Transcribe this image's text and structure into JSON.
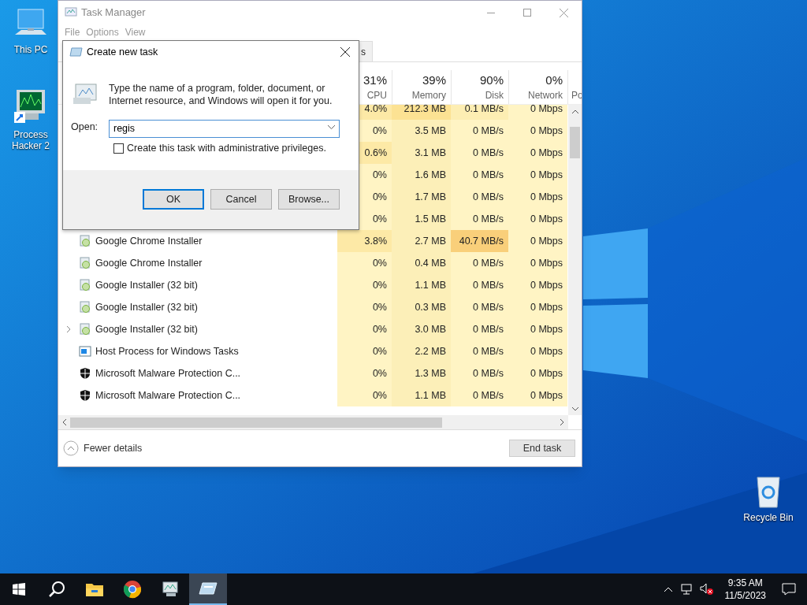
{
  "desktop_icons": [
    {
      "label": "This PC",
      "kind": "pc"
    },
    {
      "label": "Process Hacker 2",
      "kind": "hacker"
    },
    {
      "label": "Recycle Bin",
      "kind": "bin"
    }
  ],
  "task_manager": {
    "title": "Task Manager",
    "active": false,
    "menu": [
      "File",
      "Options",
      "View"
    ],
    "tabs": [
      {
        "label": "s",
        "selected": true
      }
    ],
    "columns": [
      {
        "percent": "31%",
        "label": "CPU"
      },
      {
        "percent": "39%",
        "label": "Memory"
      },
      {
        "percent": "90%",
        "label": "Disk"
      },
      {
        "percent": "0%",
        "label": "Network"
      },
      {
        "label": "Po"
      }
    ],
    "rows": [
      {
        "cells": [
          {
            "text": "4.0%",
            "color": "#fde9a6"
          },
          {
            "text": "212.3 MB",
            "color": "#fce293"
          },
          {
            "text": "0.1 MB/s",
            "color": "#fdeeb3"
          },
          {
            "text": "0 Mbps",
            "color": "#fff4c4"
          }
        ]
      },
      {
        "cells": [
          {
            "text": "0%",
            "color": "#fff4c4"
          },
          {
            "text": "3.5 MB",
            "color": "#fcefb8"
          },
          {
            "text": "0 MB/s",
            "color": "#fff4c4"
          },
          {
            "text": "0 Mbps",
            "color": "#fff4c4"
          }
        ]
      },
      {
        "cells": [
          {
            "text": "0.6%",
            "color": "#fde9a6"
          },
          {
            "text": "3.1 MB",
            "color": "#fcefb8"
          },
          {
            "text": "0 MB/s",
            "color": "#fff4c4"
          },
          {
            "text": "0 Mbps",
            "color": "#fff4c4"
          }
        ]
      },
      {
        "cells": [
          {
            "text": "0%",
            "color": "#fff4c4"
          },
          {
            "text": "1.6 MB",
            "color": "#fcefb8"
          },
          {
            "text": "0 MB/s",
            "color": "#fff4c4"
          },
          {
            "text": "0 Mbps",
            "color": "#fff4c4"
          }
        ]
      },
      {
        "cells": [
          {
            "text": "0%",
            "color": "#fff4c4"
          },
          {
            "text": "1.7 MB",
            "color": "#fcefb8"
          },
          {
            "text": "0 MB/s",
            "color": "#fff4c4"
          },
          {
            "text": "0 Mbps",
            "color": "#fff4c4"
          }
        ]
      },
      {
        "cells": [
          {
            "text": "0%",
            "color": "#fff4c4"
          },
          {
            "text": "1.5 MB",
            "color": "#fcefb8"
          },
          {
            "text": "0 MB/s",
            "color": "#fff4c4"
          },
          {
            "text": "0 Mbps",
            "color": "#fff4c4"
          }
        ]
      },
      {
        "name": "Google Chrome Installer",
        "kind": "installer",
        "expandable": false,
        "cells": [
          {
            "text": "3.8%",
            "color": "#fde9a6"
          },
          {
            "text": "2.7 MB",
            "color": "#fcefb8"
          },
          {
            "text": "40.7 MB/s",
            "color": "#f9cf7a"
          },
          {
            "text": "0 Mbps",
            "color": "#fff4c4"
          }
        ]
      },
      {
        "name": "Google Chrome Installer",
        "kind": "installer",
        "expandable": false,
        "cells": [
          {
            "text": "0%",
            "color": "#fff4c4"
          },
          {
            "text": "0.4 MB",
            "color": "#fcefb8"
          },
          {
            "text": "0 MB/s",
            "color": "#fff4c4"
          },
          {
            "text": "0 Mbps",
            "color": "#fff4c4"
          }
        ]
      },
      {
        "name": "Google Installer (32 bit)",
        "kind": "installer",
        "expandable": false,
        "cells": [
          {
            "text": "0%",
            "color": "#fff4c4"
          },
          {
            "text": "1.1 MB",
            "color": "#fcefb8"
          },
          {
            "text": "0 MB/s",
            "color": "#fff4c4"
          },
          {
            "text": "0 Mbps",
            "color": "#fff4c4"
          }
        ]
      },
      {
        "name": "Google Installer (32 bit)",
        "kind": "installer",
        "expandable": false,
        "cells": [
          {
            "text": "0%",
            "color": "#fff4c4"
          },
          {
            "text": "0.3 MB",
            "color": "#fcefb8"
          },
          {
            "text": "0 MB/s",
            "color": "#fff4c4"
          },
          {
            "text": "0 Mbps",
            "color": "#fff4c4"
          }
        ]
      },
      {
        "name": "Google Installer (32 bit)",
        "kind": "installer",
        "expandable": true,
        "cells": [
          {
            "text": "0%",
            "color": "#fff4c4"
          },
          {
            "text": "3.0 MB",
            "color": "#fcefb8"
          },
          {
            "text": "0 MB/s",
            "color": "#fff4c4"
          },
          {
            "text": "0 Mbps",
            "color": "#fff4c4"
          }
        ]
      },
      {
        "name": "Host Process for Windows Tasks",
        "kind": "window",
        "expandable": false,
        "cells": [
          {
            "text": "0%",
            "color": "#fff4c4"
          },
          {
            "text": "2.2 MB",
            "color": "#fcefb8"
          },
          {
            "text": "0 MB/s",
            "color": "#fff4c4"
          },
          {
            "text": "0 Mbps",
            "color": "#fff4c4"
          }
        ]
      },
      {
        "name": "Microsoft Malware Protection C...",
        "kind": "shield",
        "expandable": false,
        "cells": [
          {
            "text": "0%",
            "color": "#fff4c4"
          },
          {
            "text": "1.3 MB",
            "color": "#fcefb8"
          },
          {
            "text": "0 MB/s",
            "color": "#fff4c4"
          },
          {
            "text": "0 Mbps",
            "color": "#fff4c4"
          }
        ]
      },
      {
        "name": "Microsoft Malware Protection C...",
        "kind": "shield",
        "expandable": false,
        "cells": [
          {
            "text": "0%",
            "color": "#fff4c4"
          },
          {
            "text": "1.1 MB",
            "color": "#fcefb8"
          },
          {
            "text": "0 MB/s",
            "color": "#fff4c4"
          },
          {
            "text": "0 Mbps",
            "color": "#fff4c4"
          }
        ]
      }
    ],
    "fewer_details": "Fewer details",
    "end_task": "End task"
  },
  "dialog": {
    "title": "Create new task",
    "message": "Type the name of a program, folder, document, or Internet resource, and Windows will open it for you.",
    "open_label": "Open:",
    "open_value": "regis",
    "admin": {
      "label": "Create this task with administrative privileges.",
      "checked": false
    },
    "buttons": [
      {
        "label": "OK",
        "default": true
      },
      {
        "label": "Cancel",
        "default": false
      },
      {
        "label": "Browse...",
        "default": false
      }
    ]
  },
  "taskbar": {
    "apps": [
      {
        "kind": "start",
        "active": false
      },
      {
        "kind": "search",
        "active": false
      },
      {
        "kind": "explorer",
        "active": false
      },
      {
        "kind": "chrome",
        "active": false
      },
      {
        "kind": "taskmgr",
        "active": false
      },
      {
        "kind": "run",
        "active": true
      }
    ],
    "time": "9:35 AM",
    "date": "11/5/2023"
  }
}
